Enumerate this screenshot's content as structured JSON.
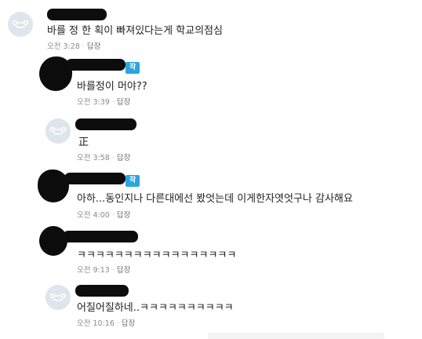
{
  "comments": [
    {
      "badge": "",
      "text": "바를 정 한 획이 빠져있다는게 학교의점심",
      "time": "오전 3:28",
      "reply_label": "답장"
    },
    {
      "badge": "작자",
      "text": "바를정이 머야??",
      "time": "오전 3:39",
      "reply_label": "답장"
    },
    {
      "badge": "",
      "text": "正",
      "time": "오전 3:58",
      "reply_label": "답장"
    },
    {
      "badge": "작자",
      "text": "아하...동인지나 다른대에선 봤엇는데 이게한자엿엇구나 감사해요",
      "time": "오전 4:00",
      "reply_label": "답장"
    },
    {
      "badge": "",
      "text": "ㅋㅋㅋㅋㅋㅋㅋㅋㅋㅋㅋㅋㅋㅋㅋㅋㅋ",
      "time": "오전 9:13",
      "reply_label": "답장"
    },
    {
      "badge": "",
      "text": "어질어질하네..ㅋㅋㅋㅋㅋㅋㅋㅋㅋㅋ",
      "time": "오전 10:16",
      "reply_label": "답장"
    }
  ],
  "colors": {
    "badge": "#2aa5e0",
    "meta": "#8a8a8a",
    "avatar_bg": "#dfe5ec"
  },
  "icons": {
    "default_avatar": "default-avatar-icon"
  }
}
